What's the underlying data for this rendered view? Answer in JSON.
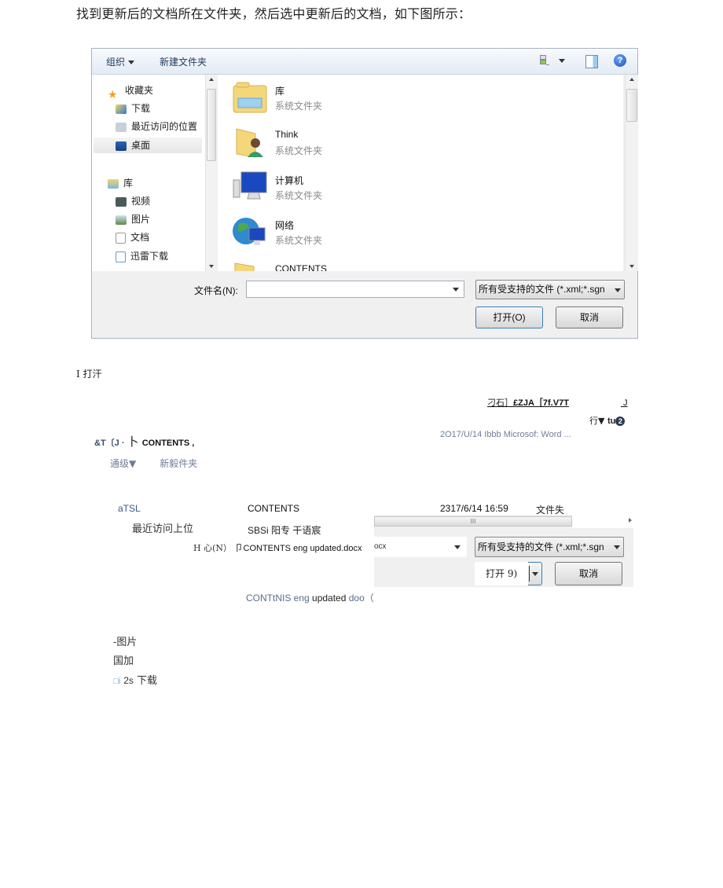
{
  "intro_text": "找到更新后的文档所在文件夹，然后选中更新后的文档，如下图所示：",
  "dialog": {
    "toolbar": {
      "organize": "组织",
      "new_folder": "新建文件夹",
      "help": "?"
    },
    "nav": [
      {
        "label": "收藏夹",
        "icon": "star-icon"
      },
      {
        "label": "下载",
        "icon": "download-folder-icon"
      },
      {
        "label": "最近访问的位置",
        "icon": "recent-places-icon"
      },
      {
        "label": "桌面",
        "icon": "desktop-icon",
        "selected": true
      },
      {
        "label": "库",
        "icon": "library-icon"
      },
      {
        "label": "视频",
        "icon": "video-icon"
      },
      {
        "label": "图片",
        "icon": "pictures-icon"
      },
      {
        "label": "文档",
        "icon": "documents-icon"
      },
      {
        "label": "迅雷下载",
        "icon": "thunder-download-icon"
      }
    ],
    "files": [
      {
        "name": "库",
        "type": "系统文件夹",
        "icon": "library-folder-icon"
      },
      {
        "name": "Think",
        "type": "系统文件夹",
        "icon": "user-folder-icon"
      },
      {
        "name": "计算机",
        "type": "系统文件夹",
        "icon": "computer-icon"
      },
      {
        "name": "网络",
        "type": "系统文件夹",
        "icon": "network-icon"
      },
      {
        "name": "CONTENTS",
        "type": "",
        "icon": "folder-icon"
      }
    ],
    "filename_label": "文件名(N):",
    "filename_value": "",
    "filter": "所有受支持的文件 (*.xml;*.sgn",
    "open_button": "打开(O)",
    "cancel_button": "取消"
  },
  "garbled": {
    "open_title": "I 打汗",
    "crumb_a": "刁石］",
    "crumb_b": "£ZJA［7f.V7T",
    "crumb_tail": " J",
    "view_a": "行▼ ",
    "view_b": "tu",
    "view_c": "2",
    "date1": "2O17/U/14 Ibbb Microsof: Word ...",
    "addr_a": "&T〔J ·  ",
    "addr_b": "卜 ",
    "addr_c": "CONTENTS ,",
    "tb_a": "通级▼",
    "tb_b": "新毅件夹",
    "fav": "aTSL",
    "contents": "CONTENTS",
    "date2": "2317/6/14 16:59",
    "type2": "文件失",
    "recent": "最近访问上位",
    "sbs": "SBSi 阳专  干语宸",
    "fn_a": "H 心(N）",
    "fn_b": "卩CONTENTS eng updated.docx",
    "contnis_a": "CONTtNIS eng ",
    "contnis_b": "updated",
    "contnis_c": " doo（",
    "pic": "-图片",
    "guojia": "国加",
    "dl_icon": "□i",
    "dl_num": "2s",
    "dl_text": " 下载",
    "frag_scroll": "III",
    "frag_input": "ocx",
    "frag_filter": "所有受支持的文件 (*.xml;*.sgn",
    "frag_open": "打开 9)",
    "frag_cancel": "取消"
  }
}
